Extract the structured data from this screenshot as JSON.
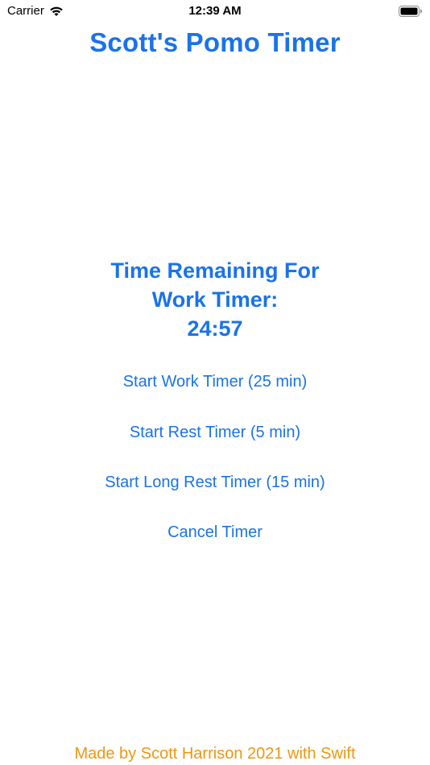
{
  "status_bar": {
    "carrier": "Carrier",
    "time": "12:39 AM"
  },
  "app": {
    "title": "Scott's Pomo Timer"
  },
  "timer": {
    "line1": "Time Remaining For",
    "line2": "Work Timer:",
    "remaining": "24:57"
  },
  "buttons": {
    "start_work": "Start Work Timer (25 min)",
    "start_rest": "Start Rest Timer (5 min)",
    "start_long_rest": "Start Long Rest Timer (15 min)",
    "cancel": "Cancel Timer"
  },
  "footer": {
    "credit": "Made by Scott Harrison 2021 with Swift"
  },
  "colors": {
    "accent": "#1a73e8",
    "footer": "#f0960e"
  },
  "icons": [
    "wifi-icon",
    "battery-icon"
  ]
}
